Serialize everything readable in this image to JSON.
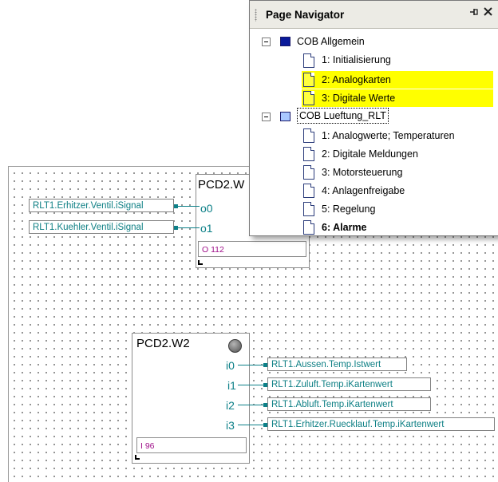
{
  "navigator": {
    "title": "Page Navigator",
    "pin_glyph": "↕",
    "close_glyph": "✕",
    "groups": [
      {
        "label": "COB Allgemein",
        "expander": "−",
        "pages": [
          {
            "label": "1: Initialisierung",
            "highlighted": false
          },
          {
            "label": "2: Analogkarten",
            "highlighted": true
          },
          {
            "label": "3: Digitale Werte",
            "highlighted": true
          }
        ]
      },
      {
        "label": "COB Lueftung_RLT",
        "expander": "−",
        "pages": [
          {
            "label": "1: Analogwerte; Temperaturen",
            "highlighted": false
          },
          {
            "label": "2: Digitale Meldungen",
            "highlighted": false
          },
          {
            "label": "3: Motorsteuerung",
            "highlighted": false
          },
          {
            "label": "4: Anlagenfreigabe",
            "highlighted": false
          },
          {
            "label": "5: Regelung",
            "highlighted": false
          },
          {
            "label": "6: Alarme",
            "highlighted": false,
            "bold": true
          }
        ]
      }
    ]
  },
  "output_block": {
    "title": "PCD2.W",
    "pins": [
      "o0",
      "o1"
    ],
    "value": "O 112",
    "inputs": [
      "RLT1.Erhitzer.Ventil.iSignal",
      "RLT1.Kuehler.Ventil.iSignal"
    ]
  },
  "input_block": {
    "title": "PCD2.W2",
    "pins": [
      "i0",
      "i1",
      "i2",
      "i3"
    ],
    "value": "I 96",
    "outputs": [
      "RLT1.Aussen.Temp.Istwert",
      "RLT1.Zuluft.Temp.iKartenwert",
      "RLT1.Abluft.Temp.iKartenwert",
      "RLT1.Erhitzer.Ruecklauf.Temp.iKartenwert"
    ]
  },
  "colors": {
    "signal_text": "#0d7f84",
    "value_text": "#a0108a",
    "highlight": "#ffff00"
  }
}
